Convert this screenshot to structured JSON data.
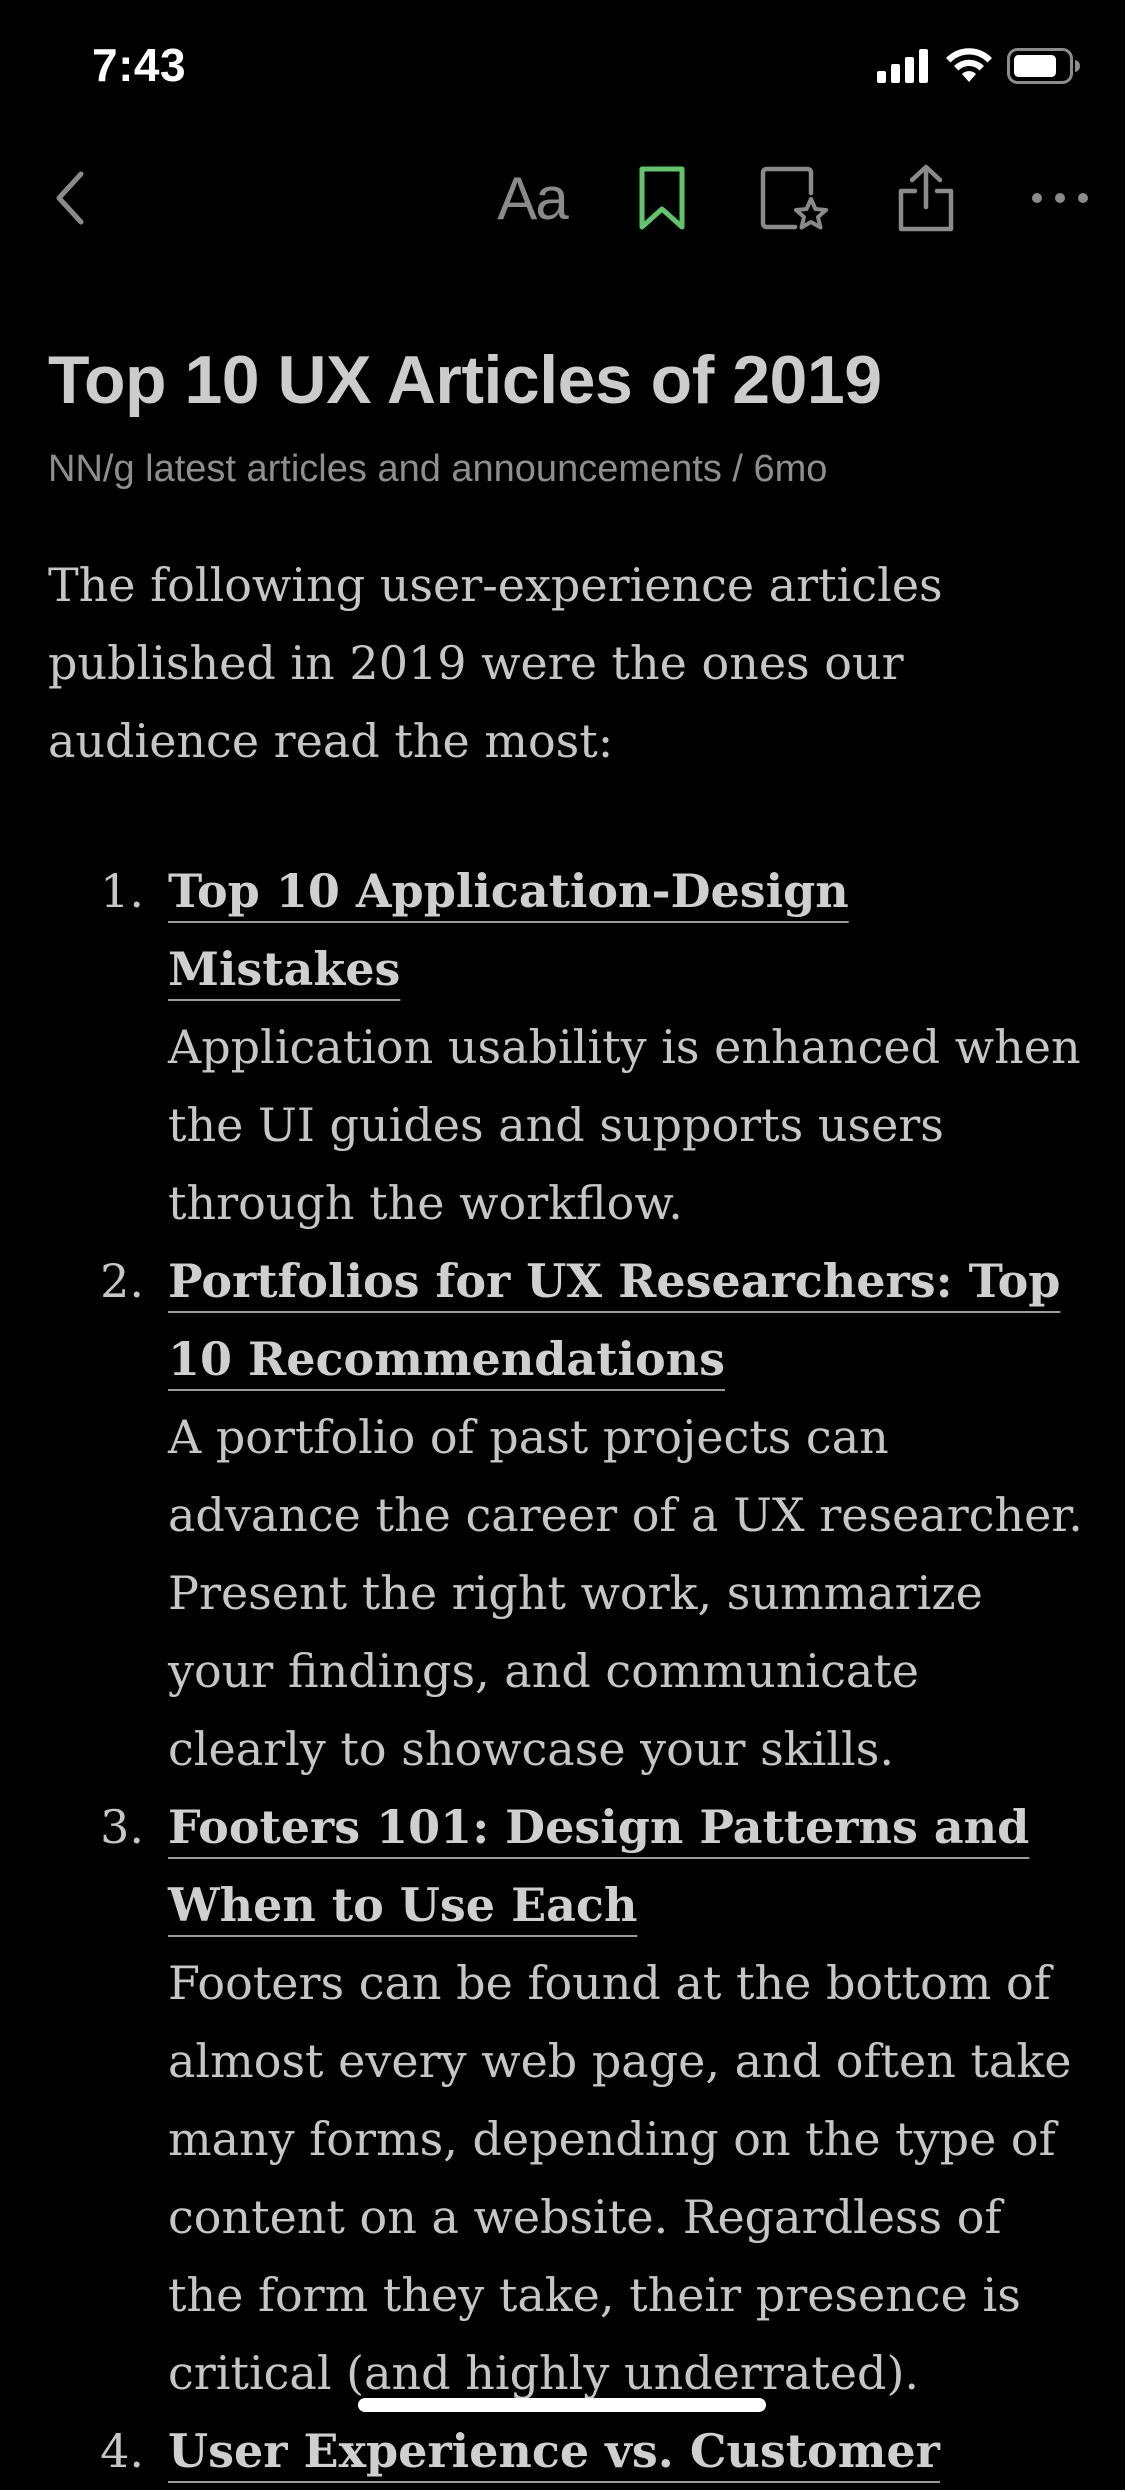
{
  "status_bar": {
    "time": "7:43",
    "icons": [
      "signal-icon",
      "wifi-icon",
      "battery-icon"
    ]
  },
  "toolbar": {
    "back_icon": "chevron-left-icon",
    "font_label": "Aa",
    "bookmark_icon": "bookmark-icon",
    "bookmark_color": "#5fc66a",
    "favorite_icon": "star-page-icon",
    "share_icon": "share-icon",
    "more_icon": "more-icon"
  },
  "article": {
    "title": "Top 10 UX Articles of 2019",
    "meta": "NN/g latest articles and announcements / 6mo",
    "intro": "The following user-experience articles published in 2019 were the ones our audience read the most:",
    "items": [
      {
        "number": "1.",
        "title": "Top 10 Application-Design Mistakes",
        "description": "Application usability is enhanced when the UI guides and supports users through the workflow."
      },
      {
        "number": "2.",
        "title": "Portfolios for UX Researchers: Top 10 Recommendations",
        "description": "A portfolio of past projects can advance the career of a UX researcher. Present the right work, summarize your findings, and communicate clearly to showcase your skills."
      },
      {
        "number": "3.",
        "title": "Footers 101: Design Patterns and When to Use Each",
        "description": "Footers can be found at the bottom of almost every web page, and often take many forms, depending on the type of content on a website. Regardless of the form they take, their presence is critical (and highly underrated)."
      },
      {
        "number": "4.",
        "title": "User Experience vs. Customer",
        "description": ""
      }
    ]
  }
}
